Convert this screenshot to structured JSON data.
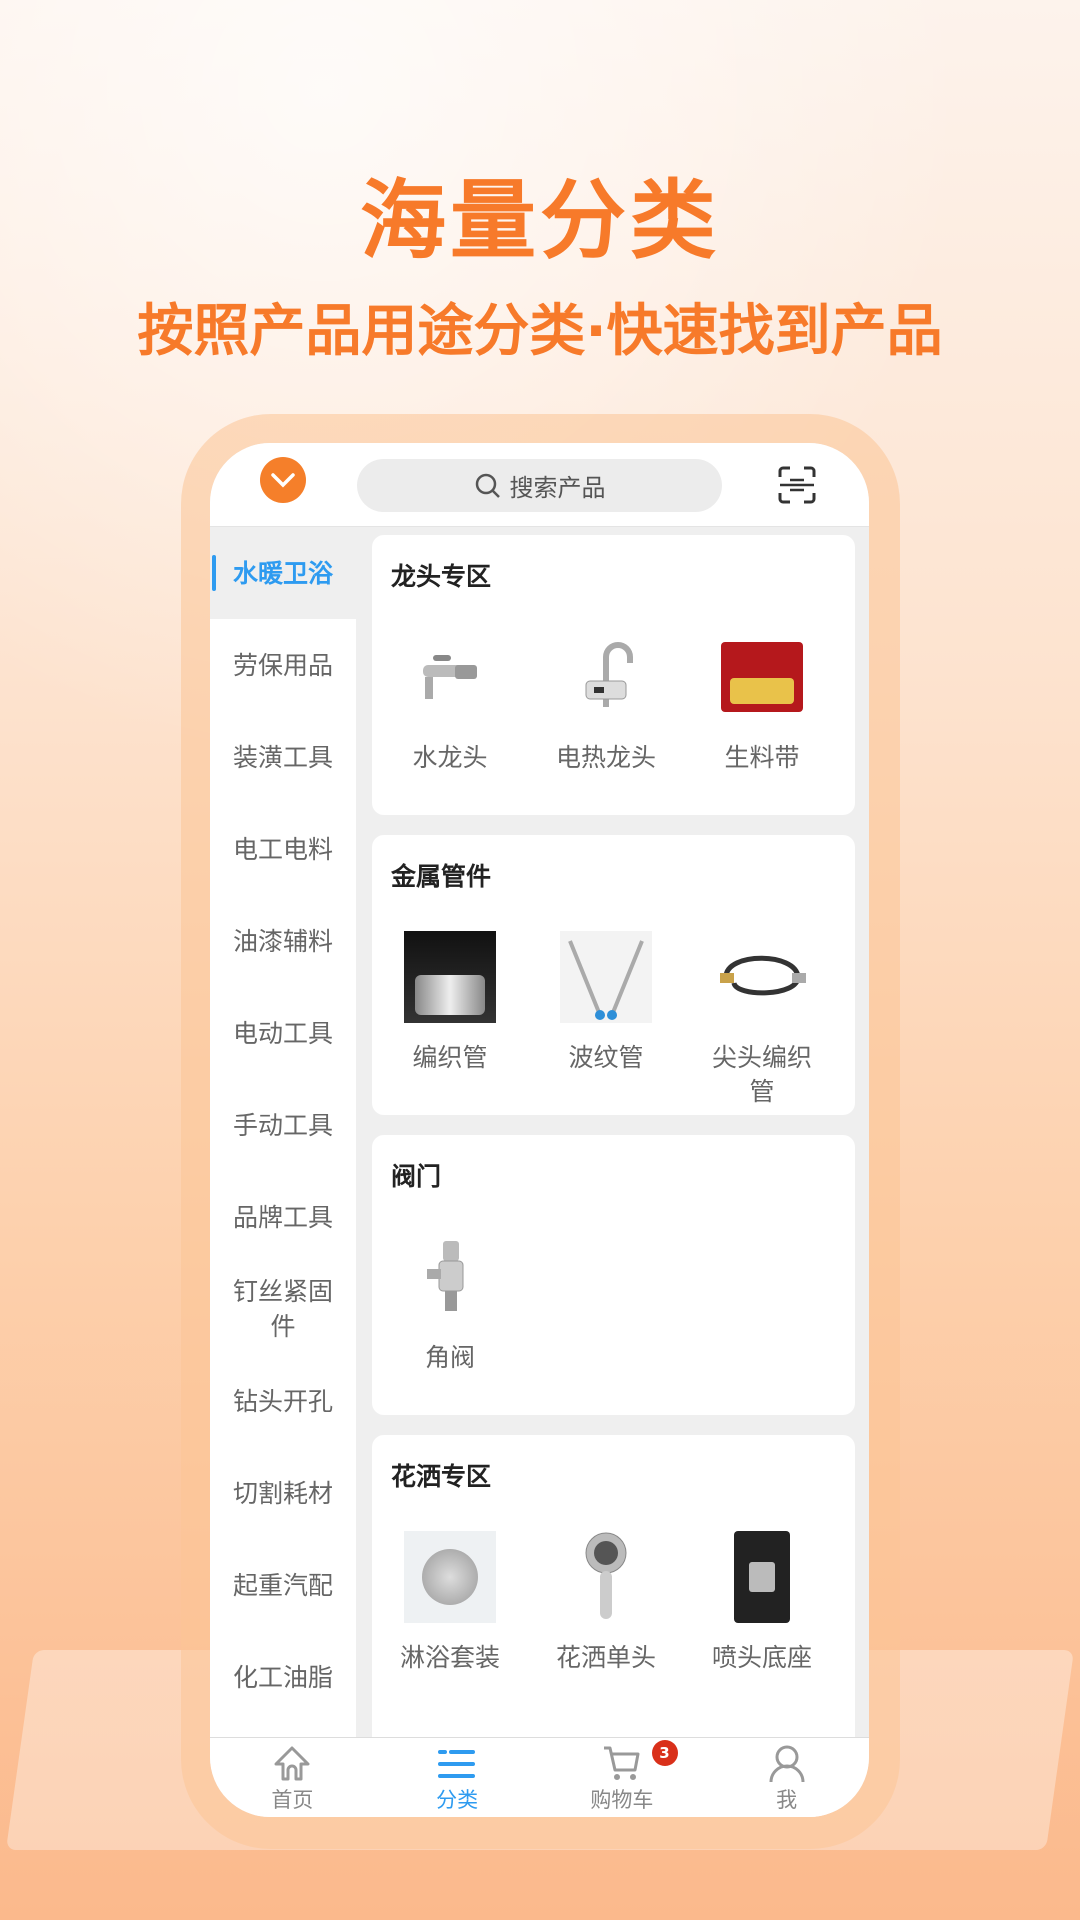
{
  "promo": {
    "title": "海量分类",
    "subtitle": "按照产品用途分类·快速找到产品"
  },
  "header": {
    "search_placeholder": "搜索产品"
  },
  "sidebar": {
    "items": [
      "水暖卫浴",
      "劳保用品",
      "装潢工具",
      "电工电料",
      "油漆辅料",
      "电动工具",
      "手动工具",
      "品牌工具",
      "钉丝紧固件",
      "钻头开孔",
      "切割耗材",
      "起重汽配",
      "化工油脂"
    ],
    "active": "水暖卫浴"
  },
  "sections": [
    {
      "title": "龙头专区",
      "items": [
        "水龙头",
        "电热龙头",
        "生料带"
      ]
    },
    {
      "title": "金属管件",
      "items": [
        "编织管",
        "波纹管",
        "尖头编织管"
      ]
    },
    {
      "title": "阀门",
      "items": [
        "角阀"
      ]
    },
    {
      "title": "花洒专区",
      "items": [
        "淋浴套装",
        "花洒单头",
        "喷头底座"
      ]
    }
  ],
  "nav": {
    "items": [
      "首页",
      "分类",
      "购物车",
      "我"
    ],
    "active": "分类",
    "cart_badge": "3"
  },
  "colors": {
    "accent": "#f77a2a",
    "active": "#2e9bf0",
    "badge": "#d9301a"
  }
}
